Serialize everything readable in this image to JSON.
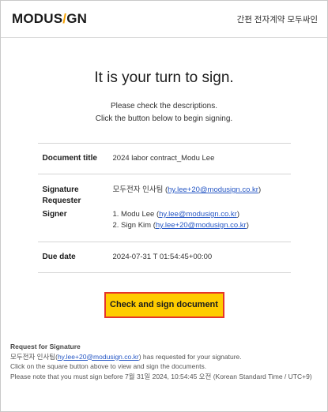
{
  "header": {
    "logo_part1": "MODUS",
    "logo_slash": "/",
    "logo_part2": "GN",
    "tagline": "간편 전자계약 모두싸인"
  },
  "main": {
    "title": "It is your turn to sign.",
    "subtitle_line1": "Please check the descriptions.",
    "subtitle_line2": "Click the button below to begin signing."
  },
  "details": {
    "document_title_label": "Document title",
    "document_title_value": "2024 labor contract_Modu Lee",
    "requester_label": "Signature Requester",
    "requester_name": "모두전자 인사팀",
    "requester_email": "hy.lee+20@modusign.co.kr",
    "signer_label": "Signer",
    "signers": [
      {
        "prefix": "1. Modu Lee",
        "email": "hy.lee@modusign.co.kr"
      },
      {
        "prefix": "2. Sign Kim",
        "email": "hy.lee+20@modusign.co.kr"
      }
    ],
    "due_label": "Due date",
    "due_value": "2024-07-31 T 01:54:45+00:00"
  },
  "cta": {
    "label": "Check and sign document",
    "color_bg": "#ffcc00",
    "color_border": "#e5352b"
  },
  "footer": {
    "title": "Request for Signature",
    "line1_name": "모두전자 인사팀",
    "line1_email": "hy.lee+20@modusign.co.kr",
    "line1_rest": " has requested for your signature.",
    "line2": "Click on the square button above to view and sign the documents.",
    "line3": "Please note that you must sign before 7월 31일 2024, 10:54:45 오전 (Korean Standard Time / UTC+9)"
  }
}
